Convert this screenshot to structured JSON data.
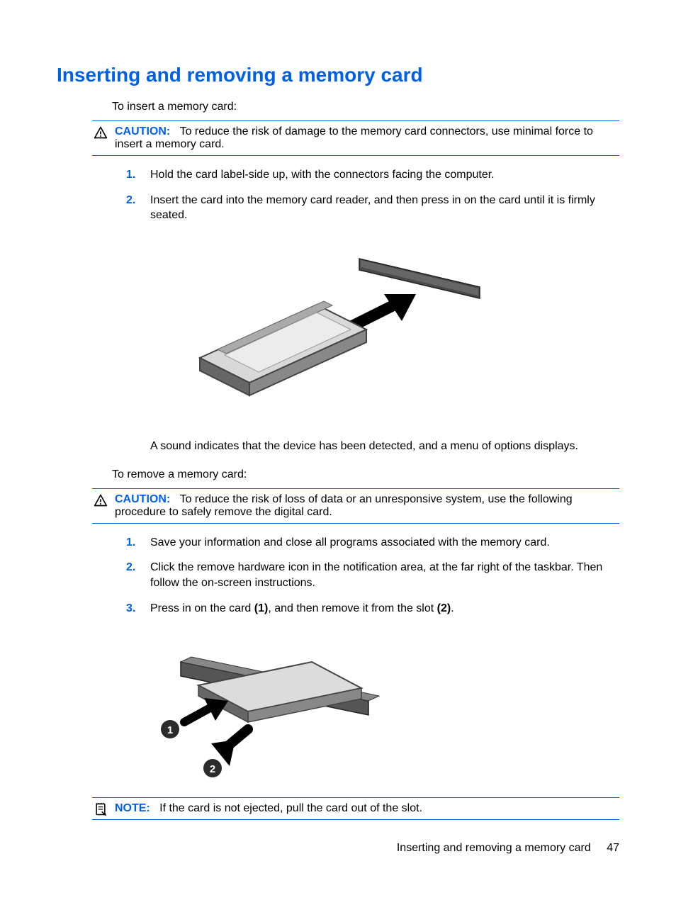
{
  "heading": "Inserting and removing a memory card",
  "insert_intro": "To insert a memory card:",
  "remove_intro": "To remove a memory card:",
  "caution1": {
    "label": "CAUTION:",
    "text": "To reduce the risk of damage to the memory card connectors, use minimal force to insert a memory card."
  },
  "caution2": {
    "label": "CAUTION:",
    "text": "To reduce the risk of loss of data or an unresponsive system, use the following procedure to safely remove the digital card."
  },
  "note": {
    "label": "NOTE:",
    "text": "If the card is not ejected, pull the card out of the slot."
  },
  "insert_steps": [
    "Hold the card label-side up, with the connectors facing the computer.",
    "Insert the card into the memory card reader, and then press in on the card until it is firmly seated."
  ],
  "after_insert_diagram": "A sound indicates that the device has been detected, and a menu of options displays.",
  "remove_steps": [
    "Save your information and close all programs associated with the memory card.",
    "Click the remove hardware icon in the notification area, at the far right of the taskbar. Then follow the on-screen instructions.",
    {
      "pre": "Press in on the card ",
      "b1": "(1)",
      "mid": ", and then remove it from the slot ",
      "b2": "(2)",
      "post": "."
    }
  ],
  "footer": {
    "title": "Inserting and removing a memory card",
    "page": "47"
  }
}
